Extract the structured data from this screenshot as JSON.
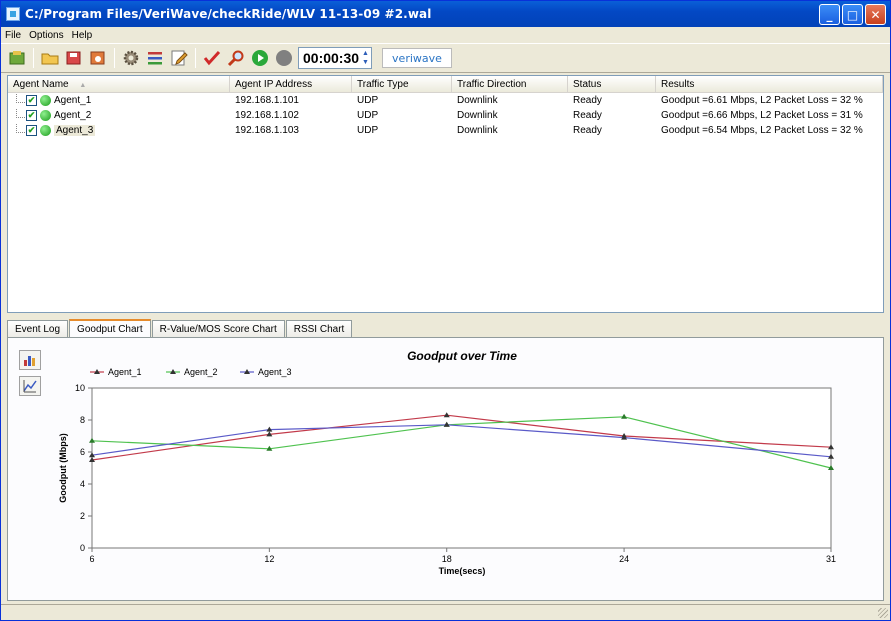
{
  "window": {
    "title": "C:/Program Files/VeriWave/checkRide/WLV 11-13-09 #2.wal",
    "minimize": "_",
    "maximize": "□",
    "close": "✕"
  },
  "menu": [
    "File",
    "Options",
    "Help"
  ],
  "toolbar": {
    "timer_value": "00:00:30",
    "logo": "veriwave"
  },
  "table": {
    "columns": [
      "Agent Name",
      "Agent IP Address",
      "Traffic Type",
      "Traffic Direction",
      "Status",
      "Results"
    ],
    "sort_indicator": "▲",
    "rows": [
      {
        "name": "Agent_1",
        "ip": "192.168.1.101",
        "type": "UDP",
        "direction": "Downlink",
        "status": "Ready",
        "results": "Goodput =6.61 Mbps, L2 Packet Loss = 32 %"
      },
      {
        "name": "Agent_2",
        "ip": "192.168.1.102",
        "type": "UDP",
        "direction": "Downlink",
        "status": "Ready",
        "results": "Goodput =6.66 Mbps, L2 Packet Loss = 31 %"
      },
      {
        "name": "Agent_3",
        "ip": "192.168.1.103",
        "type": "UDP",
        "direction": "Downlink",
        "status": "Ready",
        "results": "Goodput =6.54 Mbps, L2 Packet Loss = 32 %"
      }
    ]
  },
  "tabs": [
    "Event Log",
    "Goodput Chart",
    "R-Value/MOS Score Chart",
    "RSSI Chart"
  ],
  "active_tab": 1,
  "colors": {
    "agent_1": "#c23a4a",
    "agent_2": "#4fc24f",
    "agent_3": "#5a5ac8"
  },
  "chart_data": {
    "type": "line",
    "title": "Goodput over Time",
    "xlabel": "Time(secs)",
    "ylabel": "Goodput (Mbps)",
    "x": [
      6,
      12,
      18,
      24,
      31
    ],
    "xlim": [
      6,
      31
    ],
    "ylim": [
      0,
      10
    ],
    "yticks": [
      0,
      2,
      4,
      6,
      8,
      10
    ],
    "legend_position": "top-left",
    "grid": false,
    "series": [
      {
        "name": "Agent_1",
        "values": [
          5.5,
          7.1,
          8.3,
          7.0,
          6.3
        ]
      },
      {
        "name": "Agent_2",
        "values": [
          6.7,
          6.2,
          7.7,
          8.2,
          5.0
        ]
      },
      {
        "name": "Agent_3",
        "values": [
          5.8,
          7.4,
          7.7,
          6.9,
          5.7
        ]
      }
    ]
  }
}
